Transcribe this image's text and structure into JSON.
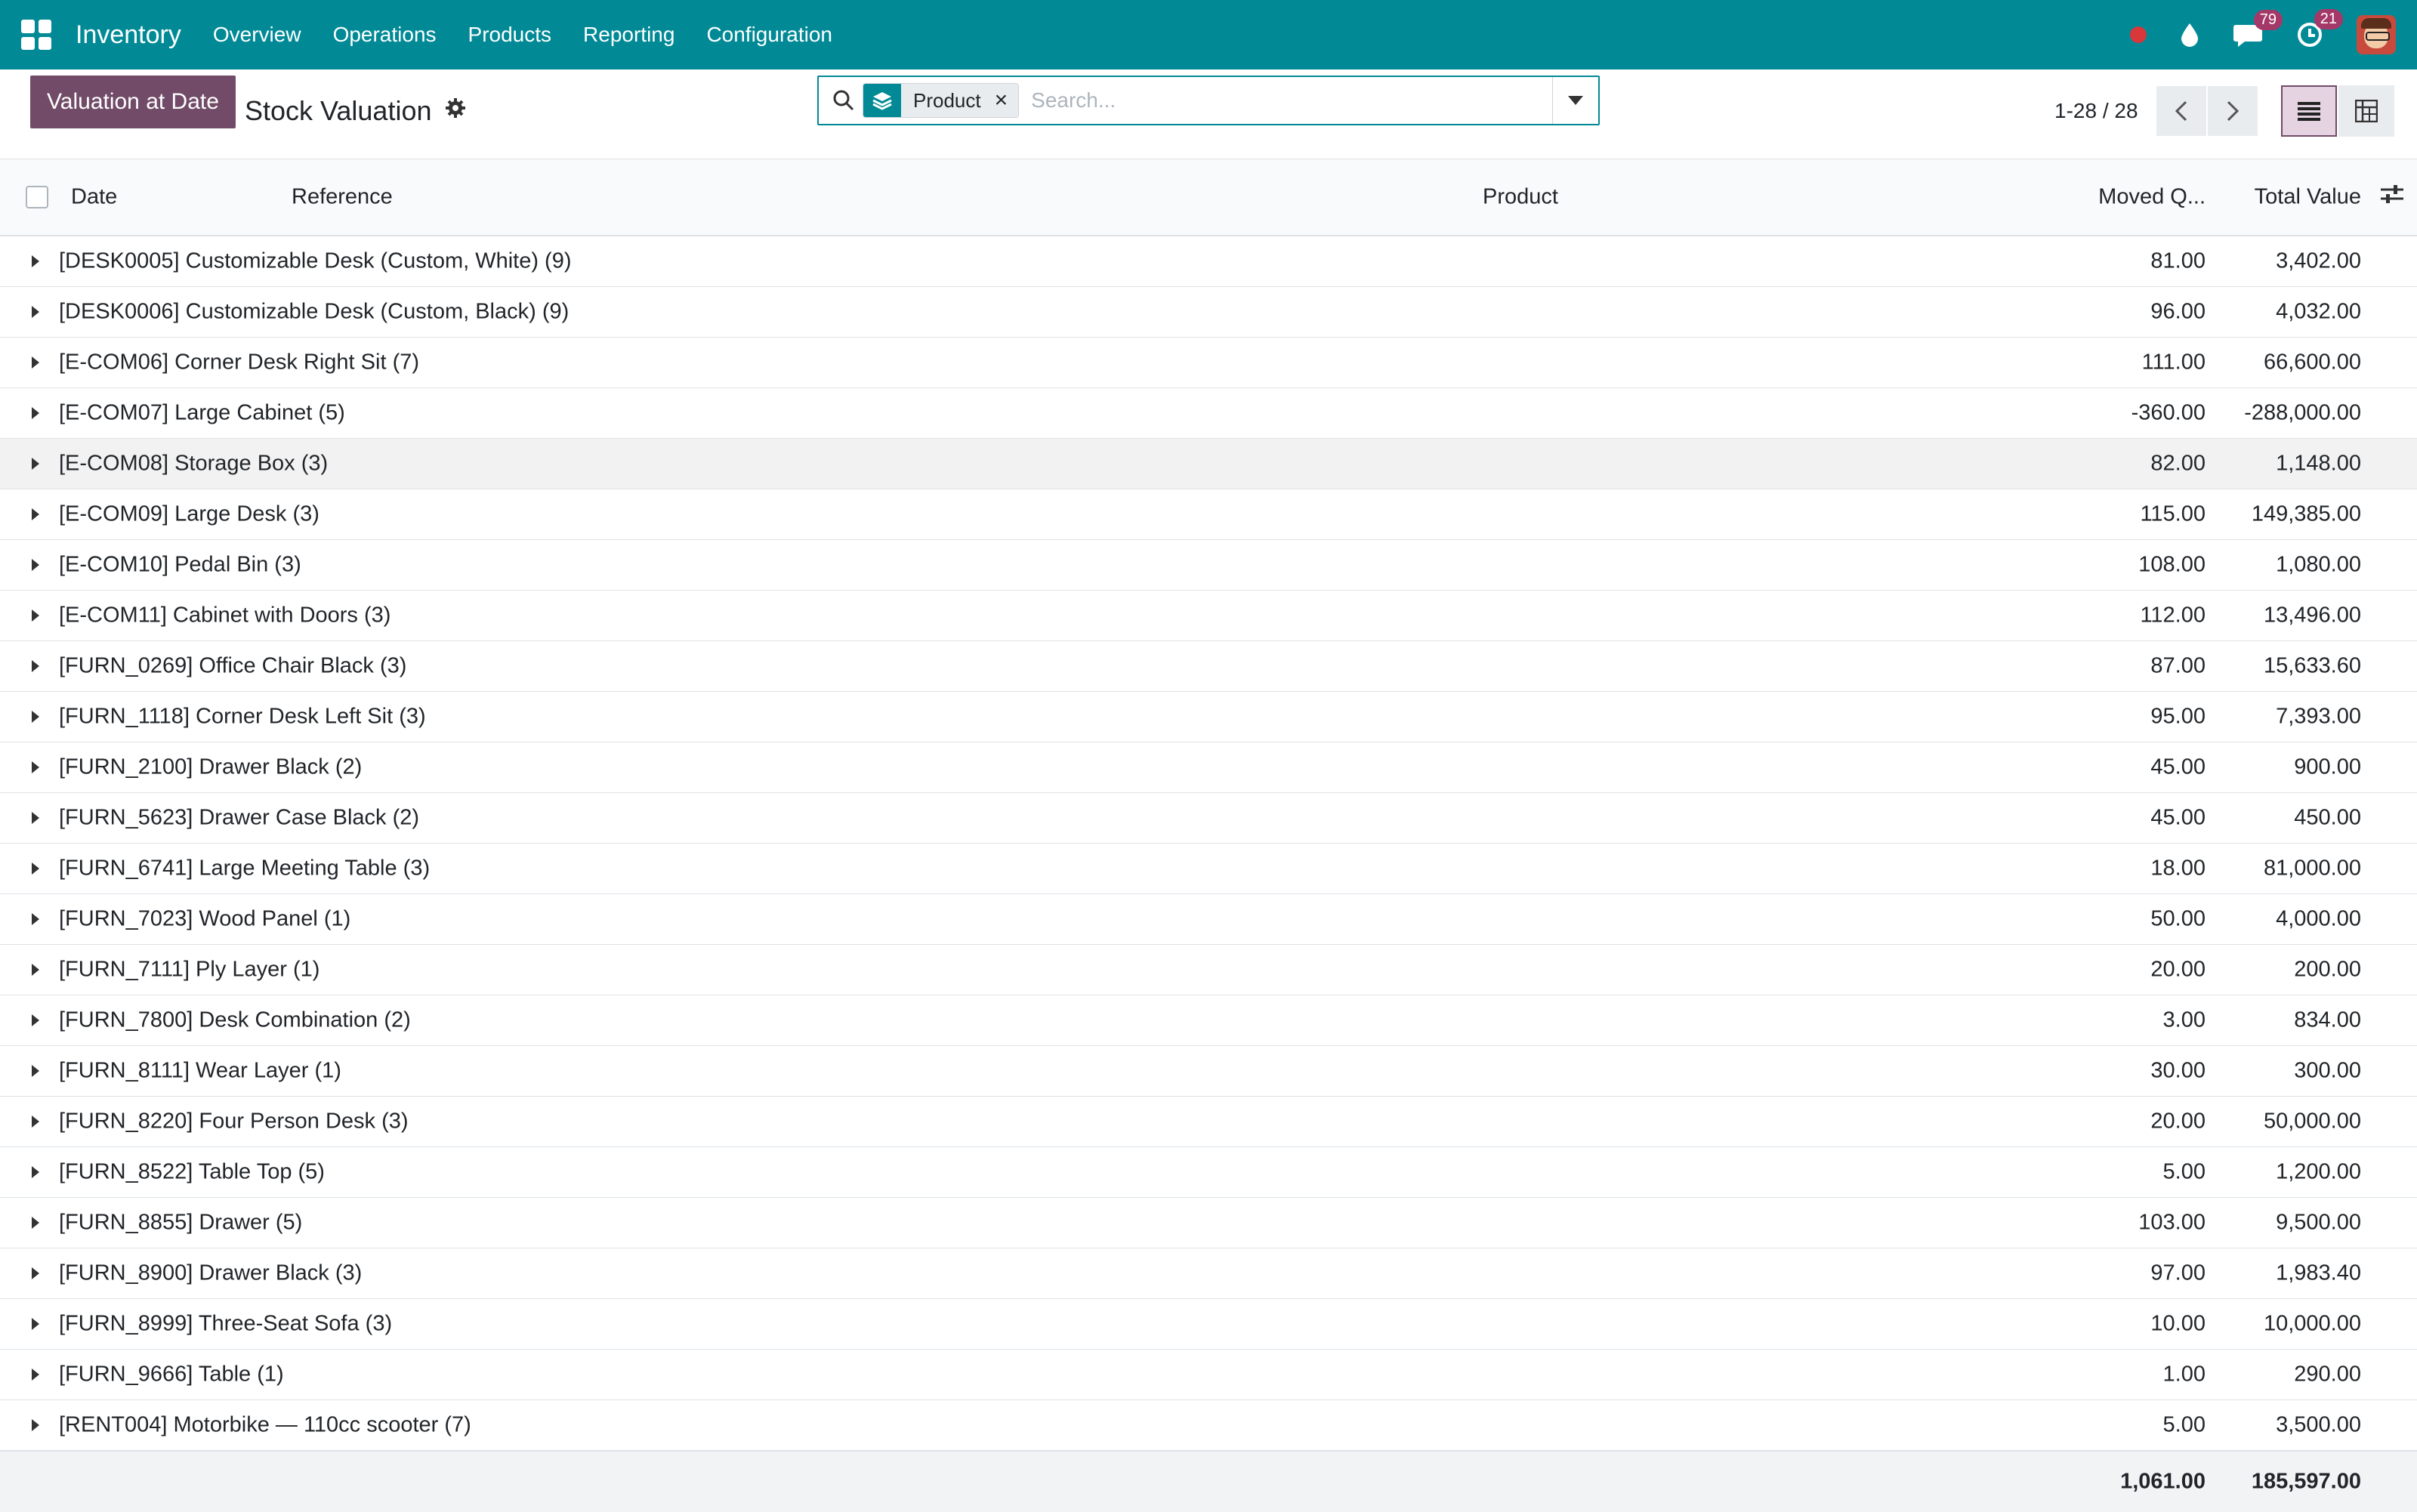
{
  "nav": {
    "app_name": "Inventory",
    "menu": [
      "Overview",
      "Operations",
      "Products",
      "Reporting",
      "Configuration"
    ],
    "badges": {
      "messages": "79",
      "activities": "21"
    }
  },
  "control": {
    "valuation_button": "Valuation at Date",
    "title": "Stock Valuation",
    "facet_label": "Product",
    "search_placeholder": "Search...",
    "pager": "1-28 / 28"
  },
  "columns": {
    "date": "Date",
    "reference": "Reference",
    "product": "Product",
    "moved_qty": "Moved Q...",
    "total_value": "Total Value"
  },
  "groups": [
    {
      "name": "[DESK0005] Customizable Desk (Custom, White) (9)",
      "qty": "81.00",
      "value": "3,402.00"
    },
    {
      "name": "[DESK0006] Customizable Desk (Custom, Black) (9)",
      "qty": "96.00",
      "value": "4,032.00"
    },
    {
      "name": "[E-COM06] Corner Desk Right Sit (7)",
      "qty": "111.00",
      "value": "66,600.00"
    },
    {
      "name": "[E-COM07] Large Cabinet (5)",
      "qty": "-360.00",
      "value": "-288,000.00"
    },
    {
      "name": "[E-COM08] Storage Box (3)",
      "qty": "82.00",
      "value": "1,148.00"
    },
    {
      "name": "[E-COM09] Large Desk (3)",
      "qty": "115.00",
      "value": "149,385.00"
    },
    {
      "name": "[E-COM10] Pedal Bin (3)",
      "qty": "108.00",
      "value": "1,080.00"
    },
    {
      "name": "[E-COM11] Cabinet with Doors (3)",
      "qty": "112.00",
      "value": "13,496.00"
    },
    {
      "name": "[FURN_0269] Office Chair Black (3)",
      "qty": "87.00",
      "value": "15,633.60"
    },
    {
      "name": "[FURN_1118] Corner Desk Left Sit (3)",
      "qty": "95.00",
      "value": "7,393.00"
    },
    {
      "name": "[FURN_2100] Drawer Black (2)",
      "qty": "45.00",
      "value": "900.00"
    },
    {
      "name": "[FURN_5623] Drawer Case Black (2)",
      "qty": "45.00",
      "value": "450.00"
    },
    {
      "name": "[FURN_6741] Large Meeting Table (3)",
      "qty": "18.00",
      "value": "81,000.00"
    },
    {
      "name": "[FURN_7023] Wood Panel (1)",
      "qty": "50.00",
      "value": "4,000.00"
    },
    {
      "name": "[FURN_7111] Ply Layer (1)",
      "qty": "20.00",
      "value": "200.00"
    },
    {
      "name": "[FURN_7800] Desk Combination (2)",
      "qty": "3.00",
      "value": "834.00"
    },
    {
      "name": "[FURN_8111] Wear Layer (1)",
      "qty": "30.00",
      "value": "300.00"
    },
    {
      "name": "[FURN_8220] Four Person Desk (3)",
      "qty": "20.00",
      "value": "50,000.00"
    },
    {
      "name": "[FURN_8522] Table Top (5)",
      "qty": "5.00",
      "value": "1,200.00"
    },
    {
      "name": "[FURN_8855] Drawer (5)",
      "qty": "103.00",
      "value": "9,500.00"
    },
    {
      "name": "[FURN_8900] Drawer Black (3)",
      "qty": "97.00",
      "value": "1,983.40"
    },
    {
      "name": "[FURN_8999] Three-Seat Sofa (3)",
      "qty": "10.00",
      "value": "10,000.00"
    },
    {
      "name": "[FURN_9666] Table (1)",
      "qty": "1.00",
      "value": "290.00"
    },
    {
      "name": "[RENT004] Motorbike — 110cc scooter (7)",
      "qty": "5.00",
      "value": "3,500.00"
    }
  ],
  "totals": {
    "qty": "1,061.00",
    "value": "185,597.00"
  },
  "colors": {
    "brand": "#018a96",
    "primary": "#714b67"
  }
}
